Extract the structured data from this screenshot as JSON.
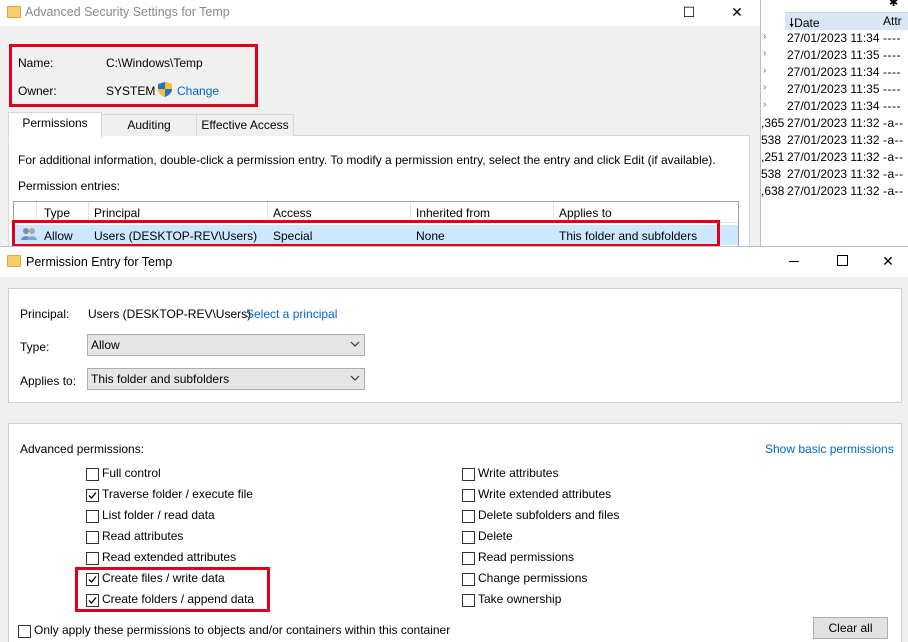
{
  "background_list": {
    "header_date": "Date",
    "header_attr": "Attr",
    "rows": [
      {
        "size": "",
        "date": "27/01/2023 11:34",
        "attr": "----"
      },
      {
        "size": "",
        "date": "27/01/2023 11:35",
        "attr": "----"
      },
      {
        "size": "",
        "date": "27/01/2023 11:34",
        "attr": "----"
      },
      {
        "size": "",
        "date": "27/01/2023 11:35",
        "attr": "----"
      },
      {
        "size": "",
        "date": "27/01/2023 11:34",
        "attr": "----"
      },
      {
        "size": ",365",
        "date": "27/01/2023 11:32",
        "attr": "-a--"
      },
      {
        "size": "538",
        "date": "27/01/2023 11:32",
        "attr": "-a--"
      },
      {
        "size": ",251",
        "date": "27/01/2023 11:32",
        "attr": "-a--"
      },
      {
        "size": "538",
        "date": "27/01/2023 11:32",
        "attr": "-a--"
      },
      {
        "size": ",638",
        "date": "27/01/2023 11:32",
        "attr": "-a--"
      }
    ]
  },
  "advanced_window": {
    "title": "Advanced Security Settings for Temp",
    "name_label": "Name:",
    "name_value": "C:\\Windows\\Temp",
    "owner_label": "Owner:",
    "owner_value": "SYSTEM",
    "change_link": "Change",
    "tabs": [
      "Permissions",
      "Auditing",
      "Effective Access"
    ],
    "info_text": "For additional information, double-click a permission entry. To modify a permission entry, select the entry and click Edit (if available).",
    "entries_label": "Permission entries:",
    "columns": [
      "Type",
      "Principal",
      "Access",
      "Inherited from",
      "Applies to"
    ],
    "selected_row": {
      "type": "Allow",
      "principal": "Users (DESKTOP-REV\\Users)",
      "access": "Special",
      "inherited": "None",
      "applies": "This folder and subfolders"
    }
  },
  "permission_window": {
    "title": "Permission Entry for Temp",
    "principal_label": "Principal:",
    "principal_value": "Users (DESKTOP-REV\\Users)",
    "select_principal_link": "Select a principal",
    "type_label": "Type:",
    "type_value": "Allow",
    "applies_label": "Applies to:",
    "applies_value": "This folder and subfolders",
    "advanced_label": "Advanced permissions:",
    "show_basic_link": "Show basic permissions",
    "left_permissions": [
      {
        "label": "Full control",
        "checked": false
      },
      {
        "label": "Traverse folder / execute file",
        "checked": true
      },
      {
        "label": "List folder / read data",
        "checked": false
      },
      {
        "label": "Read attributes",
        "checked": false
      },
      {
        "label": "Read extended attributes",
        "checked": false
      },
      {
        "label": "Create files / write data",
        "checked": true
      },
      {
        "label": "Create folders / append data",
        "checked": true
      }
    ],
    "right_permissions": [
      {
        "label": "Write attributes",
        "checked": false
      },
      {
        "label": "Write extended attributes",
        "checked": false
      },
      {
        "label": "Delete subfolders and files",
        "checked": false
      },
      {
        "label": "Delete",
        "checked": false
      },
      {
        "label": "Read permissions",
        "checked": false
      },
      {
        "label": "Change permissions",
        "checked": false
      },
      {
        "label": "Take ownership",
        "checked": false
      }
    ],
    "only_apply_label": "Only apply these permissions to objects and/or containers within this container",
    "only_apply_checked": false,
    "clear_all_label": "Clear all"
  },
  "colors": {
    "highlight_red": "#e0001b",
    "link_blue": "#0066cc",
    "selection_blue": "#cce8ff"
  }
}
